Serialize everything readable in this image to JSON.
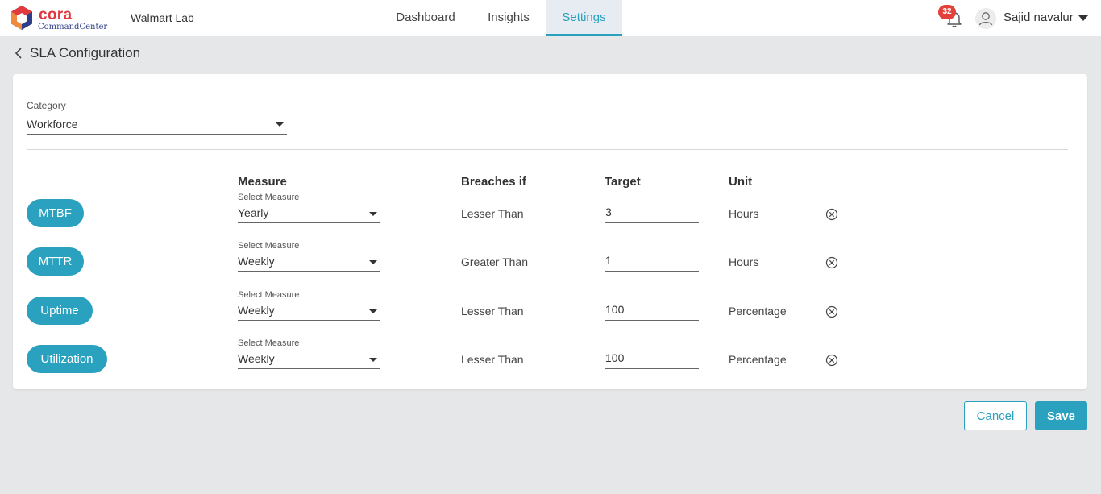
{
  "app": {
    "brand_name": "cora",
    "brand_sub": "CommandCenter",
    "tenant": "Walmart Lab"
  },
  "nav": {
    "tabs": [
      {
        "label": "Dashboard",
        "active": false
      },
      {
        "label": "Insights",
        "active": false
      },
      {
        "label": "Settings",
        "active": true
      }
    ]
  },
  "header": {
    "notification_count": "32",
    "user_name": "Sajid navalur",
    "icons": [
      "bell-icon",
      "avatar-icon",
      "chevron-down-icon"
    ]
  },
  "page": {
    "title": "SLA Configuration"
  },
  "category": {
    "label": "Category",
    "value": "Workforce"
  },
  "columns": {
    "measure": "Measure",
    "breaches": "Breaches if",
    "target": "Target",
    "unit": "Unit"
  },
  "rows": [
    {
      "name": "MTBF",
      "select_label": "Select Measure",
      "measure": "Yearly",
      "breaches": "Lesser Than",
      "target": "3",
      "unit": "Hours"
    },
    {
      "name": "MTTR",
      "select_label": "Select Measure",
      "measure": "Weekly",
      "breaches": "Greater Than",
      "target": "1",
      "unit": "Hours"
    },
    {
      "name": "Uptime",
      "select_label": "Select Measure",
      "measure": "Weekly",
      "breaches": "Lesser Than",
      "target": "100",
      "unit": "Percentage"
    },
    {
      "name": "Utilization",
      "select_label": "Select Measure",
      "measure": "Weekly",
      "breaches": "Lesser Than",
      "target": "100",
      "unit": "Percentage"
    }
  ],
  "actions": {
    "cancel": "Cancel",
    "save": "Save"
  },
  "colors": {
    "accent": "#2aa1bf",
    "badge": "#e4413b",
    "brand_red": "#e0393e",
    "brand_blue": "#2f3e8a",
    "background": "#e6e7e9"
  }
}
